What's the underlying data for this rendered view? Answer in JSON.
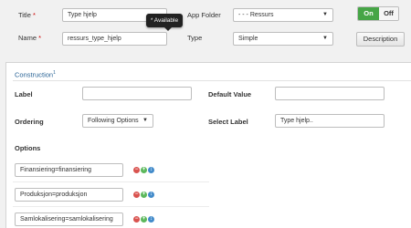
{
  "form": {
    "title_label": "Title",
    "title_value": "Type hjelp",
    "name_label": "Name",
    "name_value": "ressurs_type_hjelp",
    "required_mark": "*",
    "app_folder_label": "App Folder",
    "app_folder_value": "- - - Ressurs",
    "type_label": "Type",
    "type_value": "Simple",
    "toggle_on": "On",
    "toggle_off": "Off",
    "description_button": "Description"
  },
  "tooltip": {
    "star": "*",
    "text": "Available"
  },
  "construction": {
    "title": "Construction",
    "superscript": "1",
    "label_label": "Label",
    "label_value": "",
    "default_value_label": "Default Value",
    "default_value_value": "",
    "ordering_label": "Ordering",
    "ordering_value": "Following Options",
    "select_label_label": "Select Label",
    "select_label_value": "Type hjelp..",
    "options_label": "Options",
    "options": [
      "Finansiering=finansiering",
      "Produksjon=produksjon",
      "Samlokalisering=samlokalisering"
    ]
  },
  "colors": {
    "on_toggle": "#46a546",
    "section_title": "#2a6496",
    "remove_icon": "#d9534f",
    "add_icon": "#5cb85c",
    "move_icon": "#428bca"
  },
  "icons": [
    "remove-option-icon",
    "add-option-icon",
    "move-option-icon",
    "chevron-down-icon"
  ]
}
